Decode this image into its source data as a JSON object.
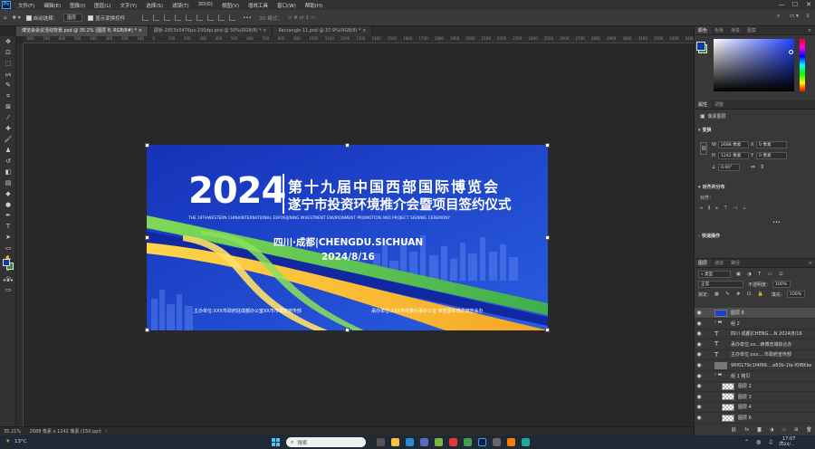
{
  "app": {
    "logo": "Ps",
    "menu": [
      "文件(F)",
      "编辑(E)",
      "图像(I)",
      "图层(L)",
      "文字(Y)",
      "选择(S)",
      "滤镜(T)",
      "3D(D)",
      "视图(V)",
      "增效工具",
      "窗口(W)",
      "帮助(H)"
    ],
    "window_controls": [
      "—",
      "☐",
      "✕"
    ]
  },
  "options": {
    "auto_select_label": "自动选择：",
    "auto_select_value": "图层",
    "show_transform_label": "显示变换控件",
    "mode_label": "3D 模式：",
    "more": "•••"
  },
  "tabs": [
    {
      "label": "博览会会议活动背景.psd @ 35.2% (图层 8, RGB/8#) *",
      "active": true
    },
    {
      "label": "展板-2953x5476px-150dpi.psd @ 50%(RGB/8) *",
      "active": false
    },
    {
      "label": "Rectangle 11.psd @ 37.9%(RGB/8) *",
      "active": false
    }
  ],
  "ruler_ticks": [
    "800",
    "700",
    "600",
    "500",
    "400",
    "300",
    "200",
    "100",
    "0",
    "100",
    "200",
    "300",
    "400",
    "500",
    "600",
    "700",
    "800",
    "900",
    "1000",
    "1100",
    "1200",
    "1300",
    "1400",
    "1500",
    "1600",
    "1700",
    "1800",
    "1900",
    "2000",
    "2100",
    "2200",
    "2300",
    "2400",
    "2500",
    "2600",
    "2700",
    "2800",
    "2900",
    "3000",
    "3100",
    "3200",
    "3300",
    "3400"
  ],
  "artwork": {
    "year": "2024",
    "title_line1": "第十九届中国西部国际博览会",
    "title_line2": "遂宁市投资环境推介会暨项目签约仪式",
    "english_line": "THE 19THWESTERN CHINAINTERNATIONAL EXPOSIJINING INVESTMENT ENVIRONMENT PROMOTION AND PROJECT SIGNING CEREMONY",
    "location": "四川·成都|CHENGDU.SICHUAN",
    "date": "2024/8/16",
    "organizer_left": "主办单位:XXX市政府驻成都办公室XX市市政府宣传部",
    "organizer_right": "承办单位:XXX市市委外事办公室  西部国际博览城宣会办"
  },
  "status": {
    "zoom": "35.21%",
    "size": "2688 像素 x 1242 像素 (150 ppi)"
  },
  "panels": {
    "top_tabs": [
      "颜色",
      "色板",
      "渐变",
      "图案"
    ],
    "props_tabs": [
      "属性",
      "调整"
    ],
    "props_kind": "像素图层",
    "transform_title": "变换",
    "w_label": "W",
    "w_value": "2688 像素",
    "x_label": "X",
    "x_value": "0 像素",
    "h_label": "H",
    "h_value": "1242 像素",
    "y_label": "Y",
    "y_value": "0 像素",
    "angle_value": "0.00°",
    "align_title": "对齐并分布",
    "align_label": "对齐：",
    "quick_title": "快速操作",
    "layers_tabs": [
      "图层",
      "通道",
      "路径"
    ],
    "filter_kind": "类型",
    "blend_mode": "正常",
    "opacity_label": "不透明度：",
    "opacity_value": "100%",
    "lock_label": "锁定：",
    "fill_label": "填充：",
    "fill_value": "100%",
    "layers": [
      {
        "name": "图层 8",
        "kind": "thumb-blue",
        "selected": true,
        "indent": 0
      },
      {
        "name": "组 2",
        "kind": "folder",
        "selected": false,
        "indent": 0
      },
      {
        "name": "四川·成都|CHENG....N 2024/8/16",
        "kind": "text",
        "selected": false,
        "indent": 0
      },
      {
        "name": "承办单位:xx...西博览城综合办",
        "kind": "text",
        "selected": false,
        "indent": 0
      },
      {
        "name": "主办单位:xxx....市政府宣传部",
        "kind": "text",
        "selected": false,
        "indent": 0
      },
      {
        "name": "96f0179c1f4f99....e83b-1fa-f0f6Kke",
        "kind": "smart",
        "selected": false,
        "indent": 0
      },
      {
        "name": "组 1 拷贝",
        "kind": "folder",
        "selected": false,
        "indent": 0
      },
      {
        "name": "图层 2",
        "kind": "thumb",
        "selected": false,
        "indent": 1
      },
      {
        "name": "图层 3",
        "kind": "thumb",
        "selected": false,
        "indent": 1
      },
      {
        "name": "图层 4",
        "kind": "thumb",
        "selected": false,
        "indent": 1
      },
      {
        "name": "图层 6",
        "kind": "thumb",
        "selected": false,
        "indent": 1
      }
    ]
  },
  "taskbar": {
    "weather": "13°C",
    "search_placeholder": "搜索",
    "time": "17:07",
    "date": "2024/..."
  }
}
